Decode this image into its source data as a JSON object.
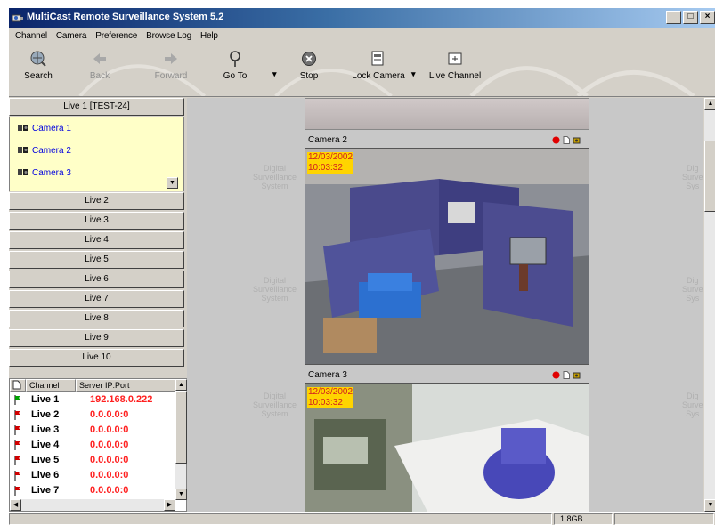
{
  "window": {
    "title": "MultiCast Remote Surveillance System 5.2",
    "controls": [
      "_",
      "̈",
      "x"
    ]
  },
  "menu": [
    "Channel",
    "Camera",
    "Preference",
    "Browse Log",
    "Help"
  ],
  "toolbar": {
    "search": "Search",
    "back": "Back",
    "forward": "Forward",
    "goto": "Go To",
    "stop": "Stop",
    "lock_camera": "Lock Camera",
    "live_channel": "Live Channel",
    "dropdown": "▾"
  },
  "live_groups": {
    "expanded": "Live 1 [TEST-24]",
    "cameras": [
      "Camera 1",
      "Camera 2",
      "Camera 3"
    ],
    "collapsed": [
      "Live 2",
      "Live 3",
      "Live 4",
      "Live 5",
      "Live 6",
      "Live 7",
      "Live 8",
      "Live 9",
      "Live 10"
    ]
  },
  "channel_table": {
    "headers": [
      "Channel",
      "Server IP:Port"
    ],
    "rows": [
      {
        "name": "Live 1",
        "ip": "192.168.0.222",
        "status": "green"
      },
      {
        "name": "Live 2",
        "ip": "0.0.0.0:0",
        "status": "red"
      },
      {
        "name": "Live 3",
        "ip": "0.0.0.0:0",
        "status": "red"
      },
      {
        "name": "Live 4",
        "ip": "0.0.0.0:0",
        "status": "red"
      },
      {
        "name": "Live 5",
        "ip": "0.0.0.0:0",
        "status": "red"
      },
      {
        "name": "Live 6",
        "ip": "0.0.0.0:0",
        "status": "red"
      },
      {
        "name": "Live 7",
        "ip": "0.0.0.0:0",
        "status": "red"
      }
    ]
  },
  "video": {
    "cameras": [
      {
        "label": "Camera 2",
        "date": "12/03/2002",
        "time": "10:03:32"
      },
      {
        "label": "Camera 3",
        "date": "12/03/2002",
        "time": "10:03:32"
      }
    ],
    "watermark_left": [
      "Digital",
      "Surveillance",
      "System"
    ],
    "watermark_right": [
      "Dig",
      "Surve",
      "Sys"
    ]
  },
  "status": {
    "disk": "1.8GB"
  },
  "colors": {
    "title_start": "#0a246a",
    "title_end": "#a6caf0",
    "ip_red": "#ff2020",
    "camera_link": "#0000e0",
    "cam_panel_bg": "#ffffc8",
    "timestamp_bg": "#ffd400"
  }
}
